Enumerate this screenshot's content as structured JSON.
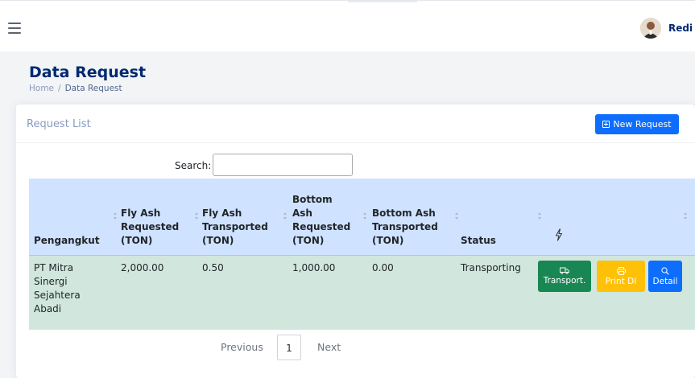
{
  "header": {
    "user_name": "Redi"
  },
  "page": {
    "title": "Data Request",
    "breadcrumb": [
      "Home",
      "Data Request"
    ]
  },
  "card": {
    "title": "Request List",
    "new_button_label": "New Request"
  },
  "search": {
    "label": "Search:",
    "value": ""
  },
  "table": {
    "columns": [
      "Pengangkut",
      "Fly Ash Requested (TON)",
      "Fly Ash Transported (TON)",
      "Bottom Ash Requested (TON)",
      "Bottom Ash Transported (TON)",
      "Status",
      "bolt-icon"
    ],
    "rows": [
      {
        "pengangkut": "PT Mitra Sinergi Sejahtera Abadi",
        "fly_ash_requested": "2,000.00",
        "fly_ash_transported": "0.50",
        "bottom_ash_requested": "1,000.00",
        "bottom_ash_transported": "0.00",
        "status": "Transporting",
        "actions": [
          "Transport.",
          "Print DI",
          "Detail"
        ]
      }
    ]
  },
  "pagination": {
    "previous": "Previous",
    "current": "1",
    "next": "Next"
  },
  "colors": {
    "primary": "#0d6efd",
    "success": "#198754",
    "warning": "#ffc107",
    "header_row": "#cfe2ff",
    "data_row": "#d1e7dd",
    "title": "#012970"
  }
}
